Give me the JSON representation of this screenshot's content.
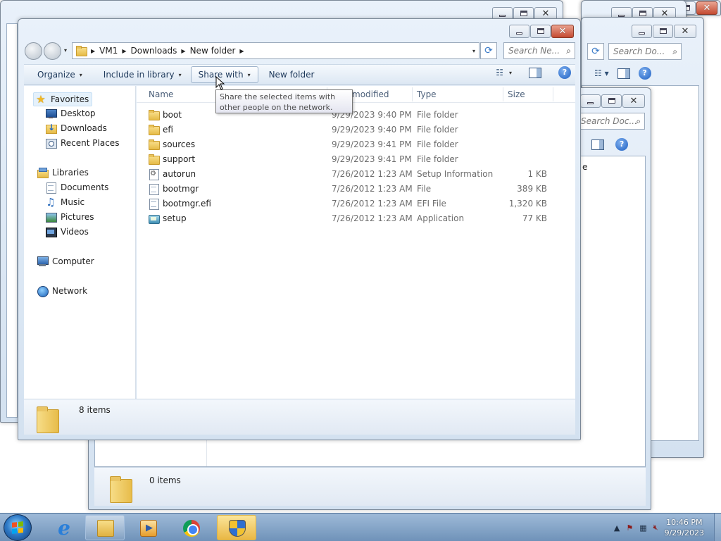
{
  "main_window": {
    "breadcrumbs": [
      "VM1",
      "Downloads",
      "New folder"
    ],
    "search_placeholder": "Search Ne...",
    "toolbar": {
      "organize": "Organize",
      "include_in_library": "Include in library",
      "share_with": "Share with",
      "new_folder": "New folder"
    },
    "tooltip": "Share the selected items with other people on the network.",
    "columns": {
      "name": "Name",
      "date_modified": "modified",
      "type": "Type",
      "size": "Size"
    },
    "nav": {
      "favorites": "Favorites",
      "favorites_items": [
        "Desktop",
        "Downloads",
        "Recent Places"
      ],
      "libraries": "Libraries",
      "libraries_items": [
        "Documents",
        "Music",
        "Pictures",
        "Videos"
      ],
      "computer": "Computer",
      "network": "Network"
    },
    "files": [
      {
        "name": "boot",
        "date": "9/29/2023 9:40 PM",
        "type": "File folder",
        "size": "",
        "icon": "folder-icon"
      },
      {
        "name": "efi",
        "date": "9/29/2023 9:40 PM",
        "type": "File folder",
        "size": "",
        "icon": "folder-icon"
      },
      {
        "name": "sources",
        "date": "9/29/2023 9:41 PM",
        "type": "File folder",
        "size": "",
        "icon": "folder-icon"
      },
      {
        "name": "support",
        "date": "9/29/2023 9:41 PM",
        "type": "File folder",
        "size": "",
        "icon": "folder-icon"
      },
      {
        "name": "autorun",
        "date": "7/26/2012 1:23 AM",
        "type": "Setup Information",
        "size": "1 KB",
        "icon": "setup-information-icon"
      },
      {
        "name": "bootmgr",
        "date": "7/26/2012 1:23 AM",
        "type": "File",
        "size": "389 KB",
        "icon": "file-icon"
      },
      {
        "name": "bootmgr.efi",
        "date": "7/26/2012 1:23 AM",
        "type": "EFI File",
        "size": "1,320 KB",
        "icon": "file-icon"
      },
      {
        "name": "setup",
        "date": "7/26/2012 1:23 AM",
        "type": "Application",
        "size": "77 KB",
        "icon": "application-icon"
      }
    ],
    "details": "8 items"
  },
  "background_windows": {
    "right_search": "Search Do...",
    "inner_search": "Search Doc...",
    "inner_fragment": "e",
    "bottom_details": "0 items"
  },
  "taskbar": {
    "apps": [
      "internet-explorer-icon",
      "windows-explorer-icon",
      "windows-media-player-icon",
      "chrome-icon",
      "user-account-control-icon"
    ],
    "clock_time": "10:46 PM",
    "clock_date": "9/29/2023"
  }
}
